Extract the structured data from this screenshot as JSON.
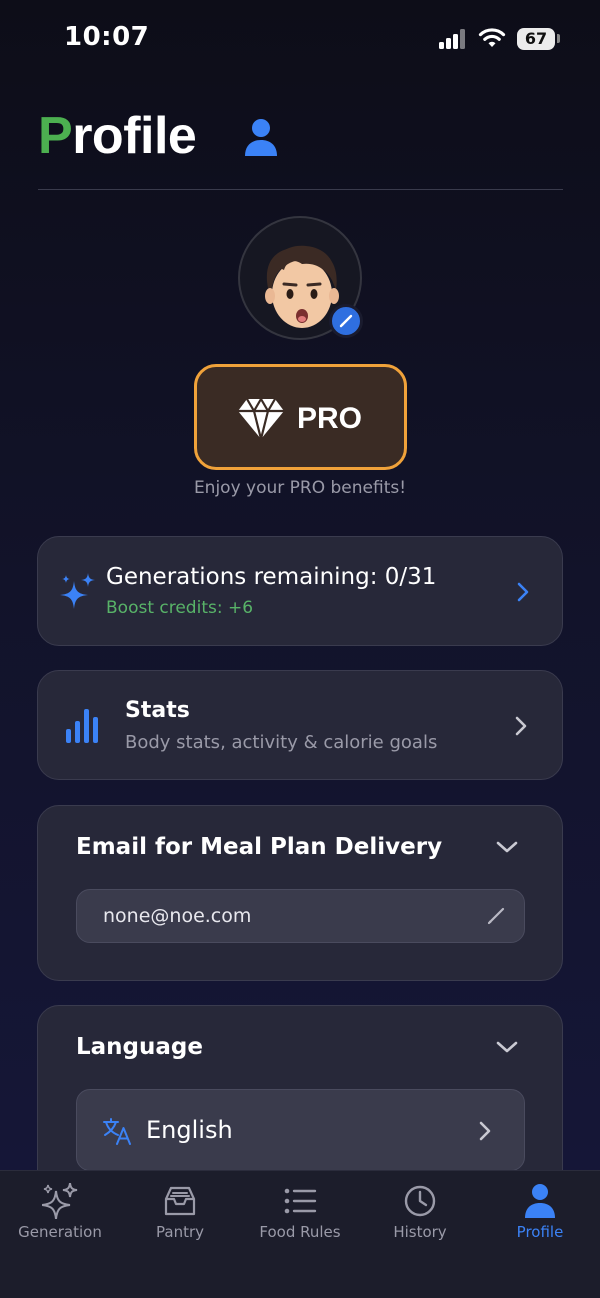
{
  "status_bar": {
    "time": "10:07",
    "battery": "67"
  },
  "header": {
    "title_first_letter": "P",
    "title_rest": "rofile"
  },
  "avatar": {
    "alt": "profile avatar"
  },
  "pro": {
    "label": "PRO",
    "subtitle": "Enjoy your PRO benefits!"
  },
  "generations": {
    "title": "Generations remaining: 0/31",
    "boost": "Boost credits: +6"
  },
  "stats": {
    "title": "Stats",
    "subtitle": "Body stats, activity & calorie goals"
  },
  "email": {
    "section_title": "Email for Meal Plan Delivery",
    "value": "none@noe.com"
  },
  "language": {
    "section_title": "Language",
    "value": "English"
  },
  "tabs": [
    {
      "label": "Generation",
      "icon": "sparkles-icon"
    },
    {
      "label": "Pantry",
      "icon": "tray-icon"
    },
    {
      "label": "Food Rules",
      "icon": "list-icon"
    },
    {
      "label": "History",
      "icon": "clock-icon"
    },
    {
      "label": "Profile",
      "icon": "person-icon",
      "active": true
    }
  ],
  "colors": {
    "accent_blue": "#3b82f6",
    "accent_green": "#4caf50",
    "pro_border": "#f0a23a",
    "card_bg": "#272839"
  }
}
